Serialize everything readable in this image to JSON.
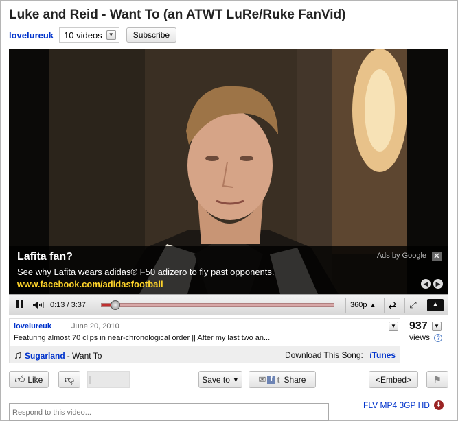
{
  "title": "Luke and Reid - Want To (an ATWT LuRe/Ruke FanVid)",
  "channel": {
    "name": "lovelureuk",
    "videos_label": "10 videos",
    "subscribe_label": "Subscribe"
  },
  "ad": {
    "title": "Lafita fan?",
    "text": "See why Lafita wears adidas® F50 adizero to fly past opponents.",
    "url": "www.facebook.com/adidasfootball",
    "ads_by": "Ads by Google",
    "close": "✕"
  },
  "player": {
    "time": "0:13 / 3:37",
    "progress": 0.06,
    "quality": "360p"
  },
  "description": {
    "user": "lovelureuk",
    "separator": "|",
    "date": "June 20, 2010",
    "text": "Featuring almost 70 clips in near-chronological order || After my last two an...",
    "artist": "Sugarland",
    "song": "- Want To",
    "download_label": "Download This Song:",
    "itunes": "iTunes"
  },
  "views": {
    "count": "937",
    "label": "views",
    "help": "?"
  },
  "actions": {
    "like": "Like",
    "save_to": "Save to",
    "share": "Share",
    "embed": "<Embed>"
  },
  "comment": {
    "placeholder": "Respond to this video..."
  },
  "formats": "FLV MP4 3GP HD",
  "colors": {
    "link": "#0033cc",
    "ad_url": "#ffd42a",
    "progress": "#c03030"
  },
  "icons": [
    "pause-icon",
    "volume-icon",
    "popout-icon",
    "fullscreen-icon",
    "expand-icon",
    "thumbs-up-icon",
    "thumbs-down-icon",
    "mail-icon",
    "facebook-icon",
    "twitter-icon",
    "flag-icon",
    "music-note-icon",
    "download-icon",
    "help-icon"
  ]
}
